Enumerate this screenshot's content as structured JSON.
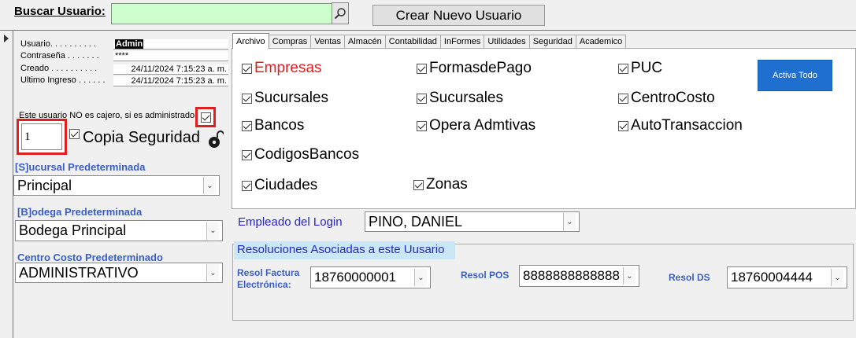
{
  "search": {
    "label": "Buscar Usuario:",
    "value": ""
  },
  "create_button": "Crear Nuevo Usuario",
  "user_info": {
    "usuario_label": "Usuario. . . . . . . . . .",
    "usuario_value": "Admin",
    "contrasena_label": "Contraseña . . . . . . .",
    "contrasena_value": "****",
    "creado_label": "Creado . . . . . . . . . .",
    "creado_value": "24/11/2024 7:15:23 a. m.",
    "ultimo_label": "Ultimo Ingreso . . . . . .",
    "ultimo_value": "24/11/2024 7:15:23 a. m."
  },
  "cashier_note": "Este usuario NO es cajero, si es administrador",
  "number_value": "1",
  "copia_label": "Copia Seguridad",
  "sucursal": {
    "label": "[S]ucursal Predeterminada",
    "value": "Principal"
  },
  "bodega": {
    "label": "[B]odega Predeterminada",
    "value": "Bodega Principal"
  },
  "centro": {
    "label": "Centro Costo Predeterminado",
    "value": "ADMINISTRATIVO"
  },
  "tabs": [
    "Archivo",
    "Compras",
    "Ventas",
    "Almacén",
    "Contabilidad",
    "InFormes",
    "Utilidades",
    "Seguridad",
    "Academico"
  ],
  "permissions": {
    "col1": [
      "Empresas",
      "Sucursales",
      "Bancos",
      "CodigosBancos",
      "Ciudades"
    ],
    "col2": [
      "FormasdePago",
      "Sucursales",
      "Opera Admtivas",
      "Zonas"
    ],
    "col3": [
      "PUC",
      "CentroCosto",
      "AutoTransaccion"
    ]
  },
  "activa_button": "Activa Todo",
  "empleado": {
    "label": "Empleado del Login",
    "value": "PINO, DANIEL"
  },
  "resoluciones": {
    "title": "Resoluciones Asociadas a este Uusario",
    "factura_label": "Resol Factura Electrónica:",
    "factura_value": "18760000001",
    "pos_label": "Resol POS",
    "pos_value": "8888888888888",
    "ds_label": "Resol DS",
    "ds_value": "18760004444"
  },
  "colors": {
    "search_bg": "#ccffcc",
    "highlight_red": "#e02020",
    "button_blue": "#1f6fd1",
    "label_blue": "#3a5ec8"
  },
  "icons": [
    "search-icon",
    "lock-icon",
    "chevron-down-icon",
    "record-pointer-icon"
  ]
}
